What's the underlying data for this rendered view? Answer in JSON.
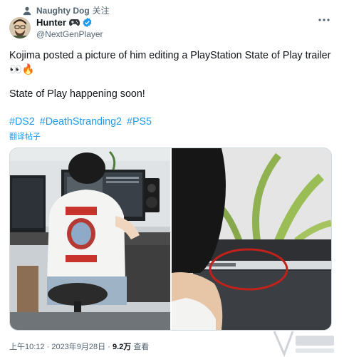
{
  "social_context": {
    "name": "Naughty Dog",
    "action": "关注"
  },
  "author": {
    "display_name": "Hunter",
    "handle": "@NextGenPlayer"
  },
  "tweet": {
    "line1": "Kojima posted a picture of him editing a PlayStation State of Play trailer",
    "line2": "👀🔥",
    "line3": "State of Play happening soon!",
    "hashtags": [
      "#DS2",
      "#DeathStranding2",
      "#PS5"
    ],
    "translate_label": "翻译帖子"
  },
  "meta": {
    "time": "上午10:12",
    "date": "2023年9月28日",
    "views_count": "9.2万",
    "views_label": "查看",
    "separator": "·"
  },
  "colors": {
    "accent": "#1d9bf0",
    "secondary_text": "#536471",
    "primary_text": "#0f1419"
  }
}
